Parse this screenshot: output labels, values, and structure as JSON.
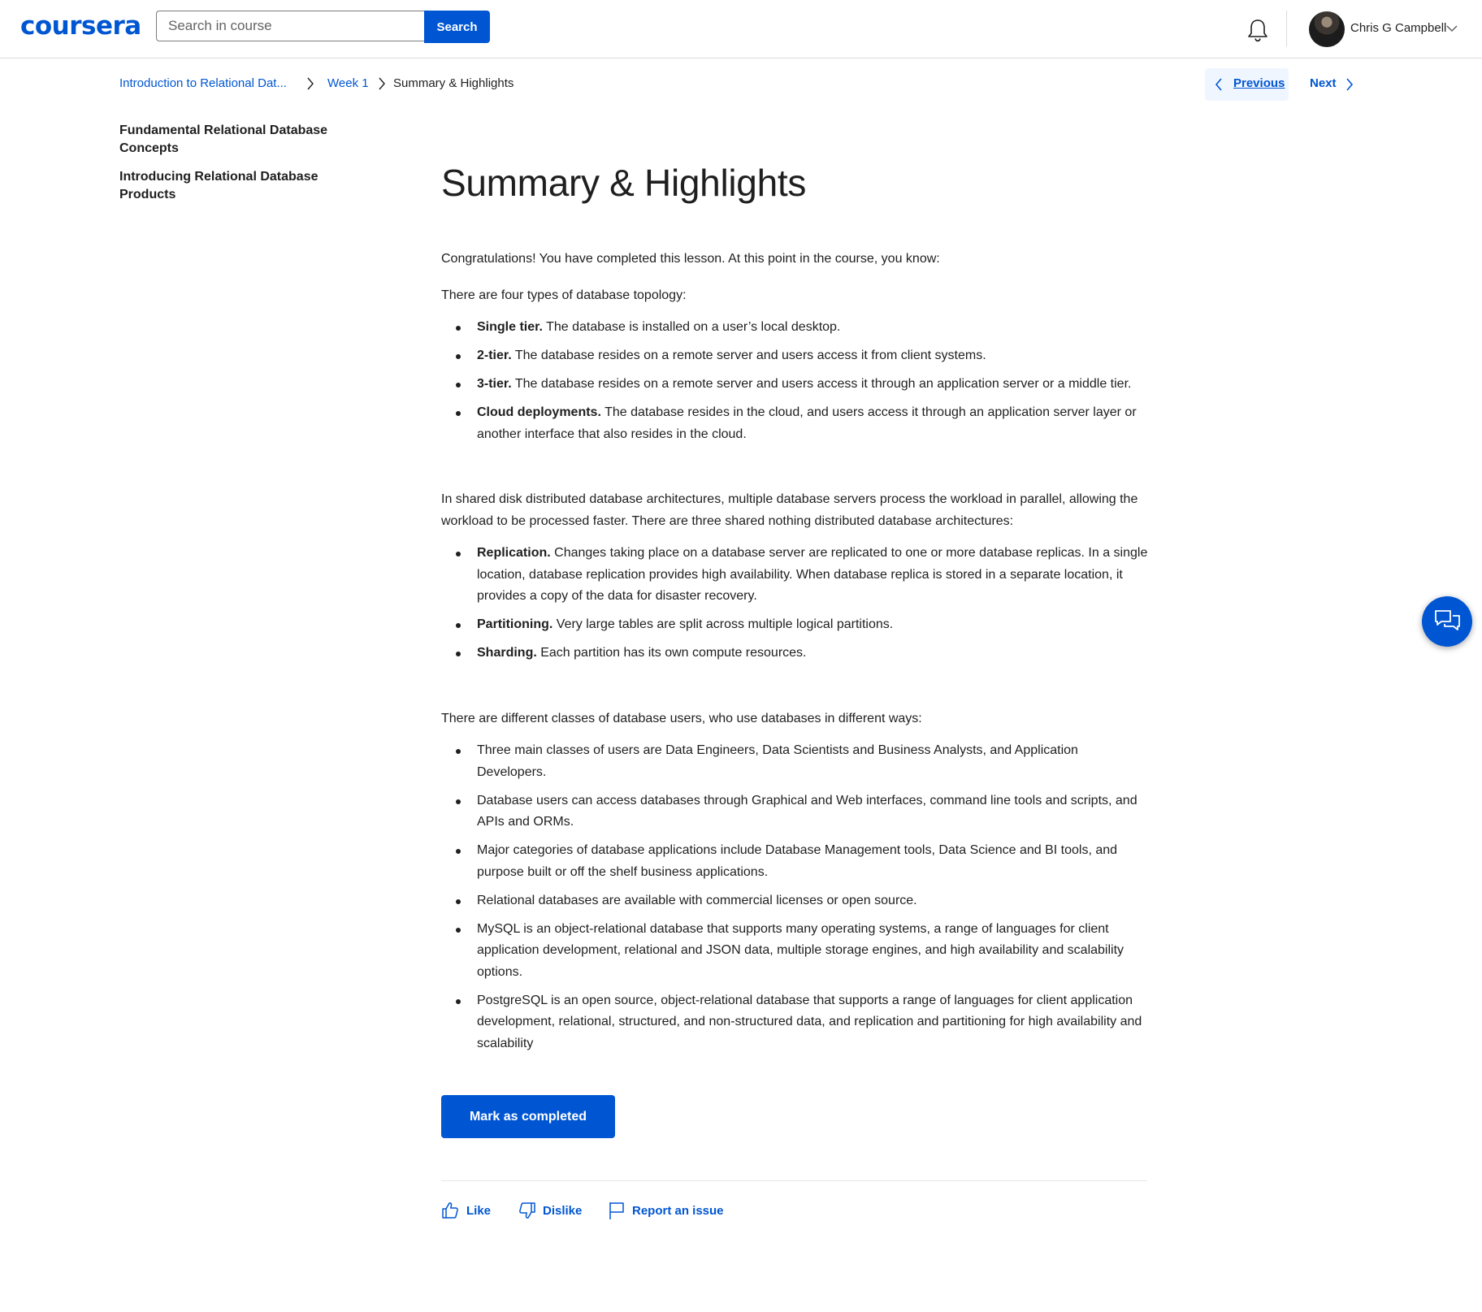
{
  "header": {
    "logo": "coursera",
    "search": {
      "placeholder": "Search in course",
      "value": "",
      "button_label": "Search"
    },
    "notifications_icon": "bell-icon",
    "user": {
      "name": "Chris G Campbell",
      "menu_icon": "chevron-down-icon"
    }
  },
  "breadcrumb": {
    "items": [
      {
        "label": "Introduction to Relational Dat..."
      },
      {
        "label": "Week 1"
      },
      {
        "label": "Summary & Highlights"
      }
    ]
  },
  "nav": {
    "previous_label": "Previous",
    "next_label": "Next"
  },
  "sidebar": {
    "items": [
      {
        "label": "Fundamental Relational Database Concepts"
      },
      {
        "label": "Introducing Relational Database Products"
      }
    ]
  },
  "content": {
    "title": "Summary & Highlights",
    "intro": "Congratulations! You have completed this lesson. At this point in the course, you know:",
    "topology_lead": "There are four types of database topology:",
    "topology_items": [
      {
        "term": "Single tier.",
        "text": " The database is installed on a user’s local desktop."
      },
      {
        "term": "2-tier.",
        "text": " The database resides on a remote server and users access it from client systems."
      },
      {
        "term": "3-tier.",
        "text": " The database resides on a remote server and users access it through an application server or a middle tier."
      },
      {
        "term": "Cloud deployments.",
        "text": " The database resides in the cloud, and users access it through an application server layer or another interface that also resides in the cloud."
      }
    ],
    "distributed_lead": "In shared disk distributed database architectures, multiple database servers process the workload in parallel, allowing the workload to be processed faster. There are three shared nothing distributed database architectures:",
    "distributed_items": [
      {
        "term": "Replication.",
        "text": " Changes taking place on a database server are replicated to one or more database replicas. In a single location, database replication provides high availability. When database replica is stored in a separate location, it provides a copy of the data for disaster recovery."
      },
      {
        "term": "Partitioning.",
        "text": " Very large tables are split across multiple logical partitions."
      },
      {
        "term": "Sharding.",
        "text": " Each partition has its own compute resources."
      }
    ],
    "users_lead": "There are different classes of database users, who use databases in different ways:",
    "users_items": [
      "Three main classes of users are Data Engineers, Data Scientists and Business Analysts, and Application Developers.",
      "Database users can access databases through Graphical and Web interfaces, command line tools and scripts, and APIs and ORMs.",
      "Major categories of database applications include Database Management tools, Data Science and BI tools, and purpose built or off the shelf business applications.",
      "Relational databases are available with commercial licenses or open source.",
      "MySQL is an object-relational database that supports many operating systems, a range of languages for client application development, relational and JSON data, multiple storage engines, and high availability and scalability options.",
      "PostgreSQL is an open source, object-relational database that supports a range of languages for client application development, relational, structured, and non-structured data, and replication and partitioning for high availability and scalability"
    ]
  },
  "actions": {
    "mark_complete_label": "Mark as completed",
    "like_label": "Like",
    "dislike_label": "Dislike",
    "report_label": "Report an issue"
  },
  "colors": {
    "brand": "#0056d2",
    "text": "#1f1f1f",
    "nav_highlight": "#f0f6ff"
  }
}
